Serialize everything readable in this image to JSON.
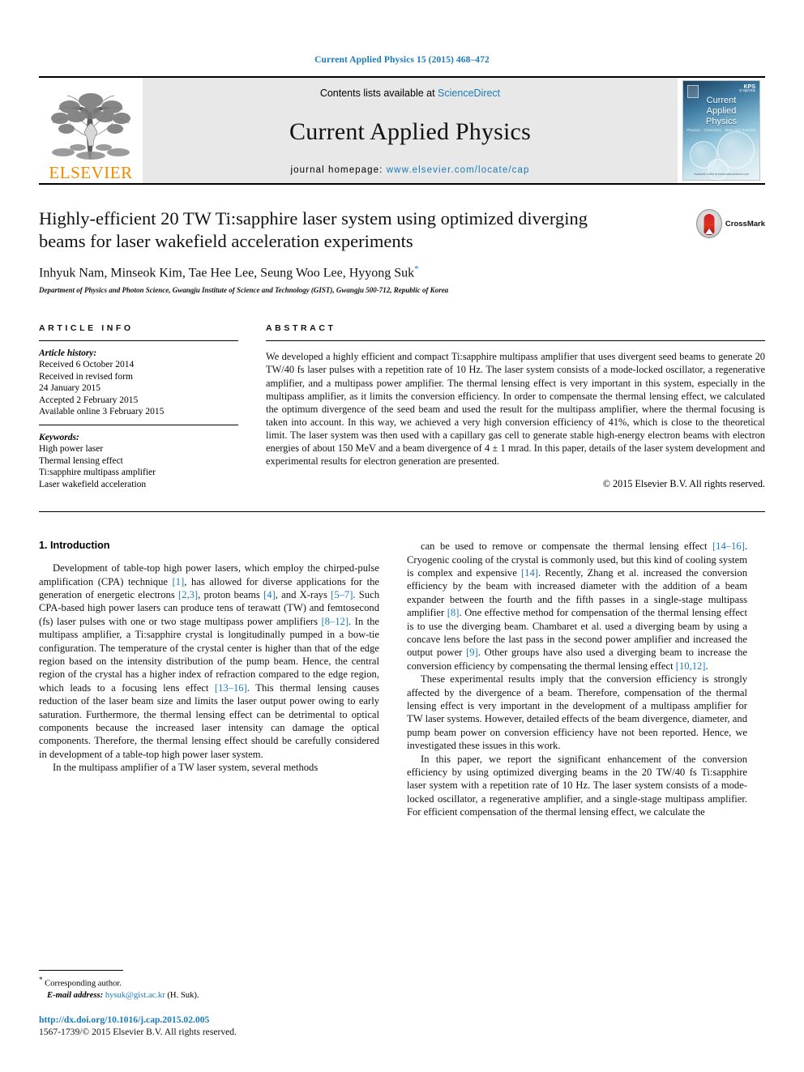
{
  "running_head": "Current Applied Physics 15 (2015) 468–472",
  "header": {
    "contents_prefix": "Contents lists available at ",
    "contents_link": "ScienceDirect",
    "journal_title": "Current Applied Physics",
    "homepage_prefix": "journal homepage: ",
    "homepage_url": "www.elsevier.com/locate/cap",
    "publisher": "ELSEVIER",
    "cover": {
      "title_line1": "Current",
      "title_line2": "Applied",
      "title_line3": "Physics",
      "subtitle": "Physics · Chemistry · Materials Science",
      "society": "KPS",
      "society_sub": "한국물리학회",
      "foot": "Available online at www.sciencedirect.com"
    }
  },
  "article": {
    "title": "Highly-efficient 20 TW Ti:sapphire laser system using optimized diverging beams for laser wakefield acceleration experiments",
    "authors": "Inhyuk Nam, Minseok Kim, Tae Hee Lee, Seung Woo Lee, Hyyong Suk",
    "affiliation": "Department of Physics and Photon Science, Gwangju Institute of Science and Technology (GIST), Gwangju 500-712, Republic of Korea",
    "crossmark_label": "CrossMark"
  },
  "info": {
    "heading": "ARTICLE INFO",
    "history_label": "Article history:",
    "history": [
      "Received 6 October 2014",
      "Received in revised form",
      "24 January 2015",
      "Accepted 2 February 2015",
      "Available online 3 February 2015"
    ],
    "keywords_label": "Keywords:",
    "keywords": [
      "High power laser",
      "Thermal lensing effect",
      "Ti:sapphire multipass amplifier",
      "Laser wakefield acceleration"
    ]
  },
  "abstract": {
    "heading": "ABSTRACT",
    "text": "We developed a highly efficient and compact Ti:sapphire multipass amplifier that uses divergent seed beams to generate 20 TW/40 fs laser pulses with a repetition rate of 10 Hz. The laser system consists of a mode-locked oscillator, a regenerative amplifier, and a multipass power amplifier. The thermal lensing effect is very important in this system, especially in the multipass amplifier, as it limits the conversion efficiency. In order to compensate the thermal lensing effect, we calculated the optimum divergence of the seed beam and used the result for the multipass amplifier, where the thermal focusing is taken into account. In this way, we achieved a very high conversion efficiency of 41%, which is close to the theoretical limit. The laser system was then used with a capillary gas cell to generate stable high-energy electron beams with electron energies of about 150 MeV and a beam divergence of 4 ± 1 mrad. In this paper, details of the laser system development and experimental results for electron generation are presented.",
    "copyright": "© 2015 Elsevier B.V. All rights reserved."
  },
  "body": {
    "section_heading": "1. Introduction",
    "left_paragraphs": [
      {
        "runs": [
          {
            "t": "Development of table-top high power lasers, which employ the chirped-pulse amplification (CPA) technique "
          },
          {
            "t": "[1]",
            "link": true
          },
          {
            "t": ", has allowed for diverse applications for the generation of energetic electrons "
          },
          {
            "t": "[2,3]",
            "link": true
          },
          {
            "t": ", proton beams "
          },
          {
            "t": "[4]",
            "link": true
          },
          {
            "t": ", and X-rays "
          },
          {
            "t": "[5–7]",
            "link": true
          },
          {
            "t": ". Such CPA-based high power lasers can produce tens of terawatt (TW) and femtosecond (fs) laser pulses with one or two stage multipass power amplifiers "
          },
          {
            "t": "[8–12]",
            "link": true
          },
          {
            "t": ". In the multipass amplifier, a Ti:sapphire crystal is longitudinally pumped in a bow-tie configuration. The temperature of the crystal center is higher than that of the edge region based on the intensity distribution of the pump beam. Hence, the central region of the crystal has a higher index of refraction compared to the edge region, which leads to a focusing lens effect "
          },
          {
            "t": "[13–16]",
            "link": true
          },
          {
            "t": ". This thermal lensing causes reduction of the laser beam size and limits the laser output power owing to early saturation. Furthermore, the thermal lensing effect can be detrimental to optical components because the increased laser intensity can damage the optical components. Therefore, the thermal lensing effect should be carefully considered in development of a table-top high power laser system."
          }
        ]
      },
      {
        "runs": [
          {
            "t": "In the multipass amplifier of a TW laser system, several methods"
          }
        ]
      }
    ],
    "right_paragraphs": [
      {
        "runs": [
          {
            "t": "can be used to remove or compensate the thermal lensing effect "
          },
          {
            "t": "[14–16]",
            "link": true
          },
          {
            "t": ". Cryogenic cooling of the crystal is commonly used, but this kind of cooling system is complex and expensive "
          },
          {
            "t": "[14]",
            "link": true
          },
          {
            "t": ". Recently, Zhang et al. increased the conversion efficiency by the beam with increased diameter with the addition of a beam expander between the fourth and the fifth passes in a single-stage multipass amplifier "
          },
          {
            "t": "[8]",
            "link": true
          },
          {
            "t": ". One effective method for compensation of the thermal lensing effect is to use the diverging beam. Chambaret et al. used a diverging beam by using a concave lens before the last pass in the second power amplifier and increased the output power "
          },
          {
            "t": "[9]",
            "link": true
          },
          {
            "t": ". Other groups have also used a diverging beam to increase the conversion efficiency by compensating the thermal lensing effect "
          },
          {
            "t": "[10,12]",
            "link": true
          },
          {
            "t": "."
          }
        ]
      },
      {
        "runs": [
          {
            "t": "These experimental results imply that the conversion efficiency is strongly affected by the divergence of a beam. Therefore, compensation of the thermal lensing effect is very important in the development of a multipass amplifier for TW laser systems. However, detailed effects of the beam divergence, diameter, and pump beam power on conversion efficiency have not been reported. Hence, we investigated these issues in this work."
          }
        ]
      },
      {
        "runs": [
          {
            "t": "In this paper, we report the significant enhancement of the conversion efficiency by using optimized diverging beams in the 20 TW/40 fs Ti:sapphire laser system with a repetition rate of 10 Hz. The laser system consists of a mode-locked oscillator, a regenerative amplifier, and a single-stage multipass amplifier. For efficient compensation of the thermal lensing effect, we calculate the"
          }
        ]
      }
    ]
  },
  "footnote": {
    "corresponding": "Corresponding author.",
    "email_label": "E-mail address:",
    "email": "hysuk@gist.ac.kr",
    "email_suffix": "(H. Suk)."
  },
  "page_footer": {
    "doi": "http://dx.doi.org/10.1016/j.cap.2015.02.005",
    "issn": "1567-1739/© 2015 Elsevier B.V. All rights reserved."
  },
  "colors": {
    "link": "#1a7bb9",
    "elsevier_orange": "#ED8B00",
    "band_gray": "#e8e8e8"
  }
}
